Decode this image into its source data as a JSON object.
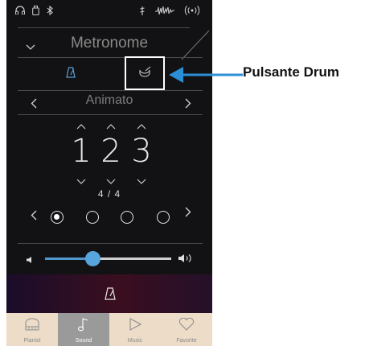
{
  "header": {
    "title": "Metronome"
  },
  "style": {
    "name": "Animato"
  },
  "tempo": {
    "digits": [
      "1",
      "2",
      "3"
    ],
    "time_signature": "4 / 4"
  },
  "beats": {
    "count": 4,
    "active_index": 0
  },
  "volume": {
    "level": 0.38
  },
  "nav": {
    "items": [
      {
        "label": "Pianist",
        "icon": "piano-icon"
      },
      {
        "label": "Sound",
        "icon": "music-note-icon"
      },
      {
        "label": "Music",
        "icon": "play-icon"
      },
      {
        "label": "Favorite",
        "icon": "heart-icon"
      }
    ],
    "active_index": 1
  },
  "callout": {
    "label": "Pulsante Drum"
  },
  "colors": {
    "accent": "#4f97cc",
    "highlight_border": "#ffffff",
    "callout_arrow": "#2b8fd6",
    "nav_bg": "#ecdcc8"
  }
}
